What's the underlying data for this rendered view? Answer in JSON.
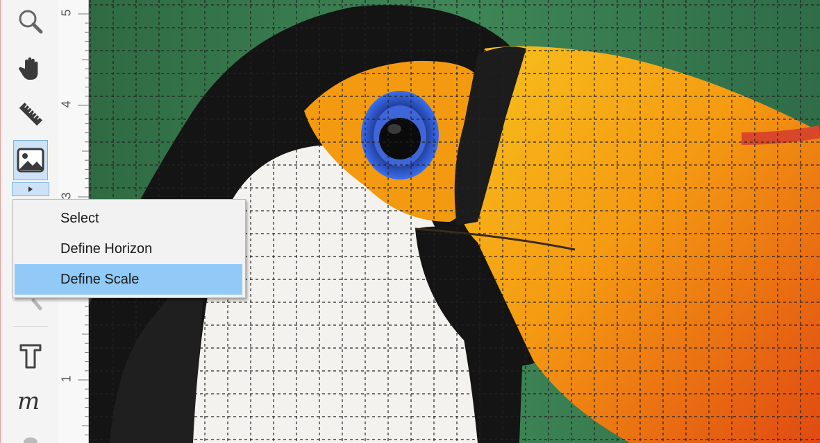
{
  "toolbar": {
    "tools": [
      {
        "name": "zoom",
        "icon": "magnifier-icon"
      },
      {
        "name": "pan",
        "icon": "hand-icon"
      },
      {
        "name": "measure",
        "icon": "ruler-icon"
      },
      {
        "name": "image",
        "icon": "image-icon",
        "active": true
      },
      {
        "name": "text",
        "icon": "text-t-icon"
      },
      {
        "name": "math",
        "icon": "script-m-icon"
      }
    ]
  },
  "ruler": {
    "labels": [
      "5",
      "4",
      "3",
      "1"
    ]
  },
  "grid": {
    "style": "dashed"
  },
  "context_menu": {
    "items": [
      {
        "label": "Select",
        "highlighted": false
      },
      {
        "label": "Define Horizon",
        "highlighted": false
      },
      {
        "label": "Define Scale",
        "highlighted": true
      }
    ]
  },
  "colors": {
    "menu_highlight": "#91c9f7",
    "tool_active": "#cde2f6",
    "grid_line": "#222222"
  }
}
